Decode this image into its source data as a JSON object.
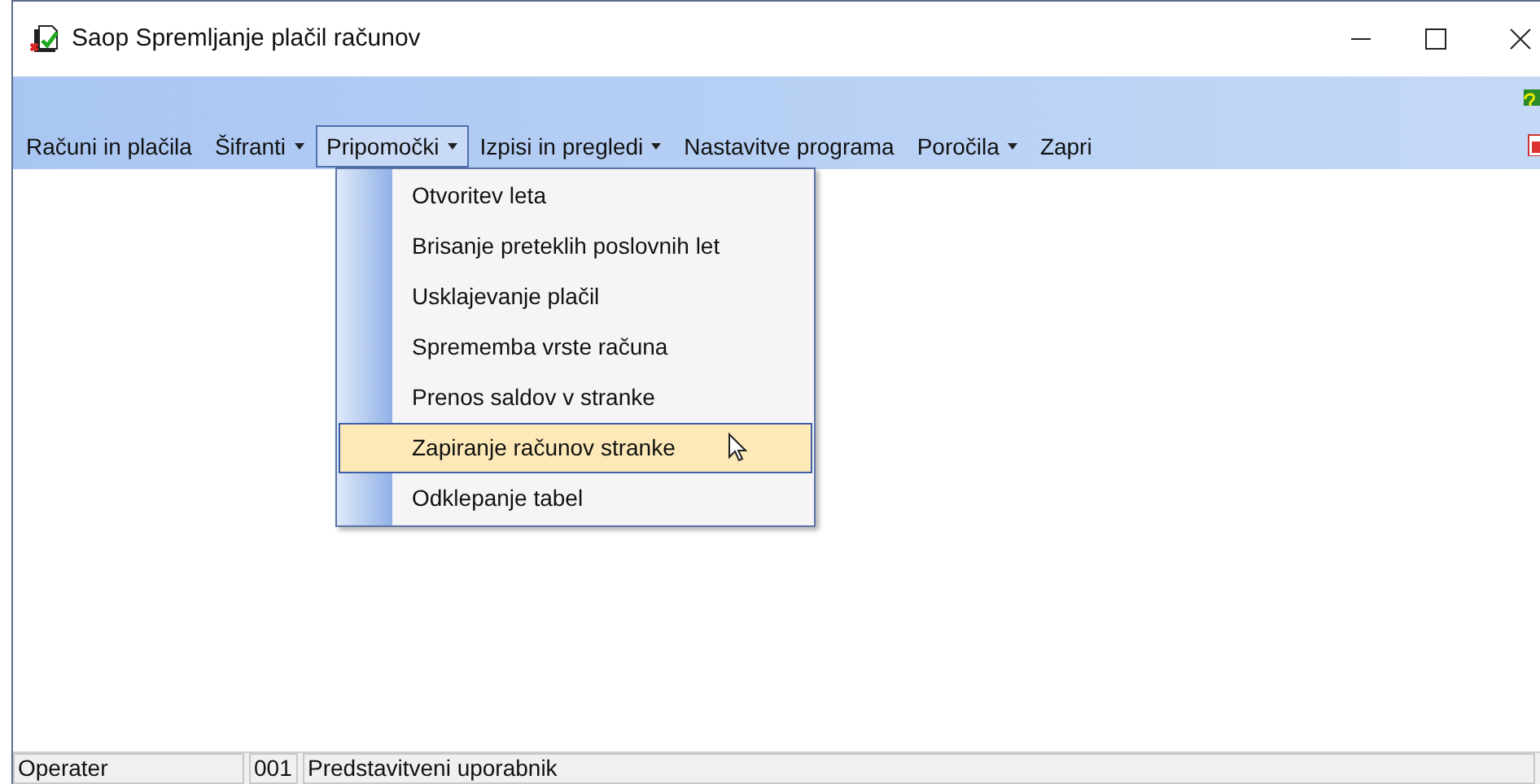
{
  "window": {
    "title": "Saop Spremljanje plačil računov"
  },
  "menu_bar": [
    {
      "label": "Računi in plačila",
      "has_dropdown": false,
      "selected": false
    },
    {
      "label": "Šifranti",
      "has_dropdown": true,
      "selected": false
    },
    {
      "label": "Pripomočki",
      "has_dropdown": true,
      "selected": true
    },
    {
      "label": "Izpisi in pregledi",
      "has_dropdown": true,
      "selected": false
    },
    {
      "label": "Nastavitve programa",
      "has_dropdown": false,
      "selected": false
    },
    {
      "label": "Poročila",
      "has_dropdown": true,
      "selected": false
    },
    {
      "label": "Zapri",
      "has_dropdown": false,
      "selected": false
    }
  ],
  "dropdown_menu": [
    {
      "label": "Otvoritev leta",
      "selected": false
    },
    {
      "label": "Brisanje preteklih poslovnih let",
      "selected": false
    },
    {
      "label": "Usklajevanje plačil",
      "selected": false
    },
    {
      "label": "Sprememba vrste računa",
      "selected": false
    },
    {
      "label": "Prenos saldov v stranke",
      "selected": false
    },
    {
      "label": "Zapiranje računov stranke",
      "selected": true
    },
    {
      "label": "Odklepanje tabel",
      "selected": false
    }
  ],
  "status_bar": [
    "Operater",
    "001",
    "Predstavitveni uporabnik"
  ]
}
